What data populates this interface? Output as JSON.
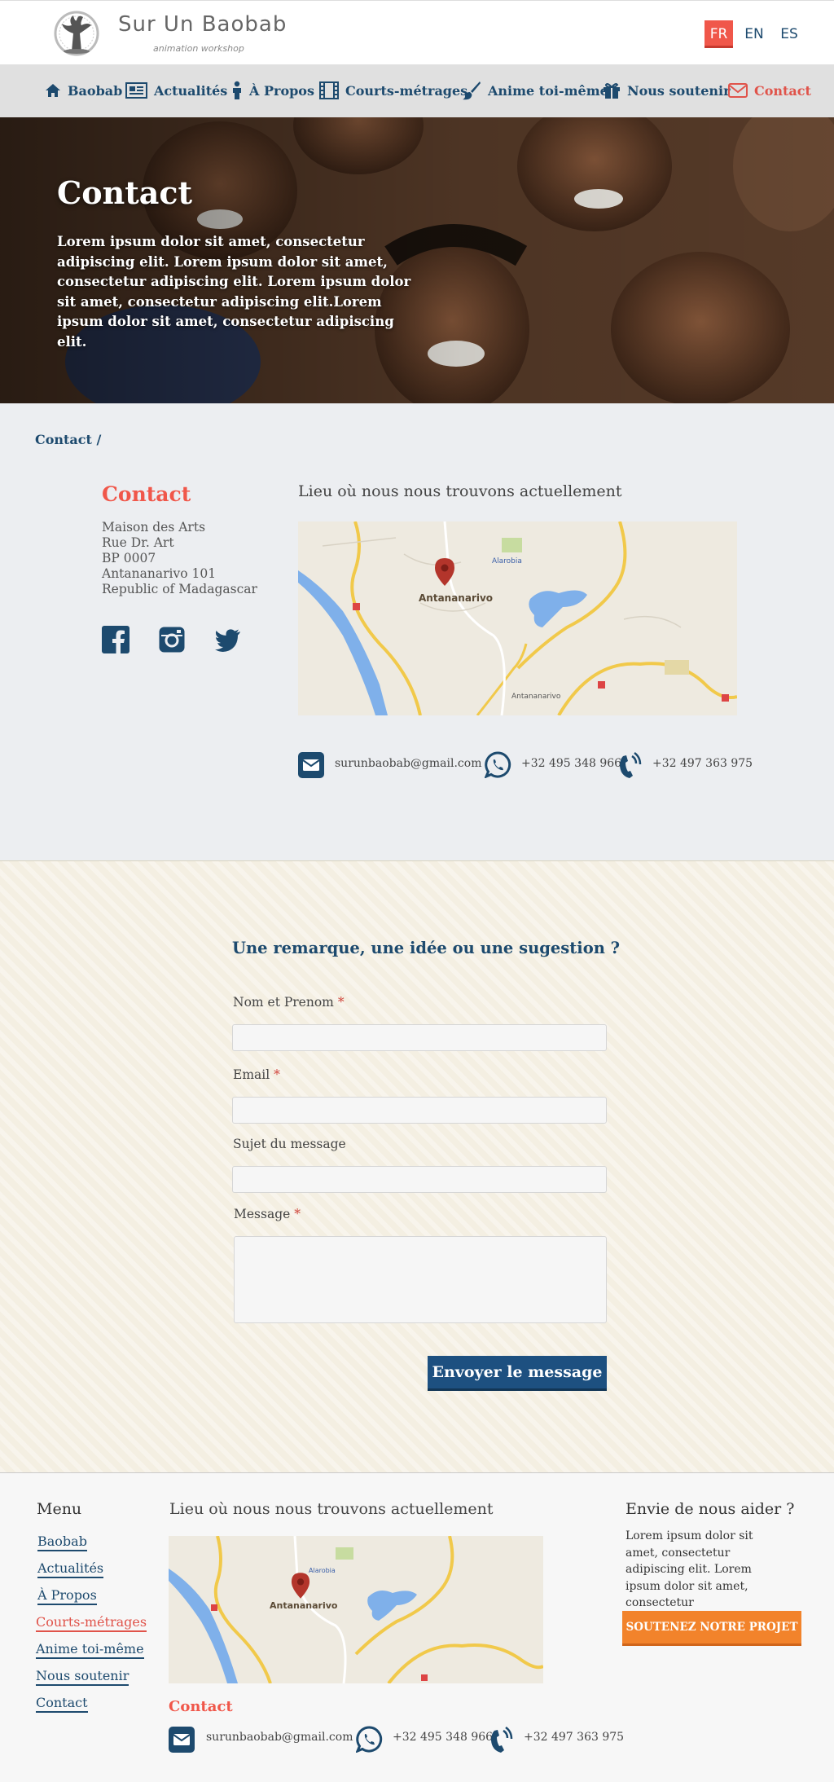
{
  "header": {
    "logo_text": "Sur Un Baobab",
    "logo_subtitle": "animation workshop",
    "languages": [
      "FR",
      "EN",
      "ES"
    ]
  },
  "nav": {
    "items": [
      {
        "label": "Baobab",
        "icon": "home-icon"
      },
      {
        "label": "Actualités",
        "icon": "newspaper-icon"
      },
      {
        "label": "À Propos",
        "icon": "person-icon"
      },
      {
        "label": "Courts-métrages",
        "icon": "film-icon"
      },
      {
        "label": "Anime toi-même",
        "icon": "brush-icon"
      },
      {
        "label": "Nous soutenir",
        "icon": "gift-icon"
      },
      {
        "label": "Contact",
        "icon": "envelope-icon"
      }
    ],
    "active_color": "#e0534a",
    "color": "#1d4a6e"
  },
  "hero": {
    "title": "Contact",
    "text": "Lorem ipsum dolor sit amet, consectetur adipiscing elit. Lorem ipsum dolor sit amet, consectetur adipiscing elit. Lorem ipsum dolor sit amet, consectetur adipiscing elit.Lorem ipsum dolor sit amet, consectetur adipiscing elit."
  },
  "breadcrumb": "Contact /",
  "contact": {
    "heading": "Contact",
    "address": [
      "Maison des Arts",
      "Rue Dr. Art",
      "BP 0007",
      "Antananarivo 101",
      "Republic of Madagascar"
    ],
    "map_title": "Lieu où nous nous trouvons actuellement",
    "map_labels": {
      "city": "Antananarivo",
      "place": "Alarobia",
      "place2": "Antananarivo"
    },
    "email": "surunbaobab@gmail.com",
    "phone_whatsapp": "+32 495 348 966",
    "phone": "+32 497 363 975"
  },
  "form": {
    "title": "Une remarque, une idée ou une sugestion ?",
    "fields": {
      "name_label": "Nom et Prenom",
      "email_label": "Email",
      "subject_label": "Sujet du message",
      "message_label": "Message",
      "required_mark": "*"
    },
    "submit_label": "Envoyer le message"
  },
  "footer": {
    "menu_title": "Menu",
    "menu": [
      "Baobab",
      "Actualités",
      "À Propos",
      "Courts-métrages",
      "Anime toi-même",
      "Nous soutenir",
      "Contact"
    ],
    "map_title": "Lieu où nous nous trouvons actuellement",
    "contact_heading": "Contact",
    "email": "surunbaobab@gmail.com",
    "phone_whatsapp": "+32 495 348 966",
    "phone": "+32 497 363 975",
    "help_title": "Envie de nous aider ?",
    "help_text": "Lorem ipsum dolor sit amet, consectetur adipiscing elit. Lorem ipsum dolor sit amet, consectetur",
    "support_button": "SOUTENEZ NOTRE PROJET"
  },
  "colors": {
    "brand_blue": "#1d4a6e",
    "accent_red": "#f0574a",
    "accent_orange": "#f2832b"
  }
}
